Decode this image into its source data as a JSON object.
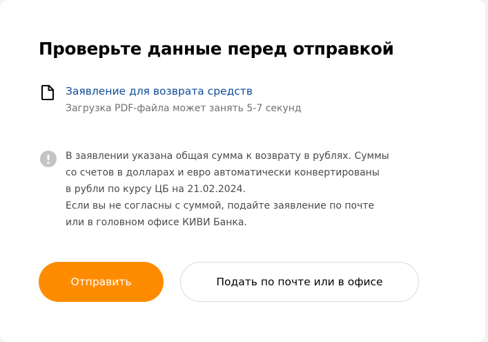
{
  "dialog": {
    "title": "Проверьте данные перед отправкой"
  },
  "document": {
    "icon": "document-icon",
    "link_label": "Заявление для возврата средств",
    "subtitle": "Загрузка PDF-файла может занять 5-7 секунд"
  },
  "notice": {
    "icon": "exclamation-circle-icon",
    "lines": [
      "В заявлении указана общая сумма к возврату в рублях. Суммы",
      "со счетов в долларах и евро автоматически конвертированы",
      "в рубли по курсу ЦБ на 21.02.2024.",
      "Если вы не согласны с суммой, подайте заявление по почте",
      "или в головном офисе КИВИ Банка."
    ]
  },
  "buttons": {
    "submit_label": "Отправить",
    "alternative_label": "Подать по почте или в офисе"
  },
  "colors": {
    "accent": "#ff8c00",
    "link": "#0f4d99",
    "muted_text": "#707070",
    "icon_gray": "#c4c4c4"
  }
}
